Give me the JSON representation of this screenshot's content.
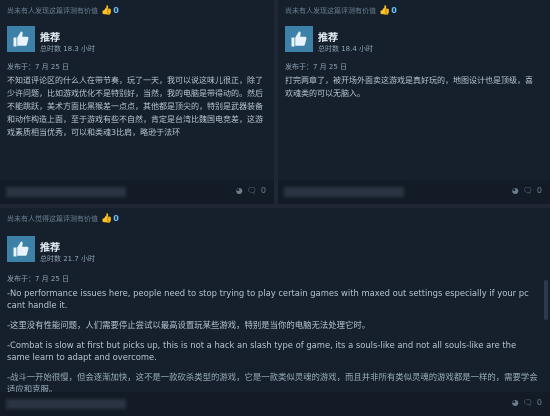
{
  "reviews": [
    {
      "helpful": "尚未有人发现这篇评测有价值",
      "helpful_count": "0",
      "recommendation": "推荐",
      "hours": "总时数 18.3 小时",
      "posted": "发布于：7 月 25 日",
      "body": [
        "不知道评论区的什么人在带节奏，玩了一天，我可以说这味儿很正，除了少许问题，比如游戏优化不是特别好，当然，我的电脑是带得动的。然后不能跳跃，美术方面比黑猴差一点点，其他都是顶尖的，特别是武器装备和动作构造上面，至于游戏有些不自然，肯定是台湾比魏国电竞差，这游戏素质相当优秀，可以和类魂3比肩，略逊于法环"
      ],
      "footer_count": "0"
    },
    {
      "helpful": "尚未有人发现这篇评测有价值",
      "helpful_count": "0",
      "recommendation": "推荐",
      "hours": "总时数 18.4 小时",
      "posted": "发布于：7 月 25 日",
      "body": [
        "打完两章了，被开场外面卖这游戏是真好玩的，地图设计也是顶级，喜欢魂类的可以无脑入。"
      ],
      "footer_count": "0"
    },
    {
      "helpful": "尚未有人觉得这篇评测有价值",
      "helpful_count": "0",
      "recommendation": "推荐",
      "hours": "总时数 21.7 小时",
      "posted": "发布于：7 月 25 日",
      "body": [
        "-No performance issues here, people need to stop trying to play certain games with maxed out settings especially if your pc cant handle it.",
        "-这里没有性能问题，人们需要停止尝试以最高设置玩某些游戏，特别是当你的电脑无法处理它时。",
        "-Combat is slow at first but picks up, this is not a hack an slash type of game, its a souls-like and not all souls-like are the same learn to adapt and overcome.",
        "-战斗一开始很慢，但会逐渐加快，这不是一款砍杀类型的游戏，它是一款类似灵魂的游戏，而且并非所有类似灵魂的游戏都是一样的，需要学会适应和克服。"
      ],
      "footer_count": "0"
    }
  ]
}
